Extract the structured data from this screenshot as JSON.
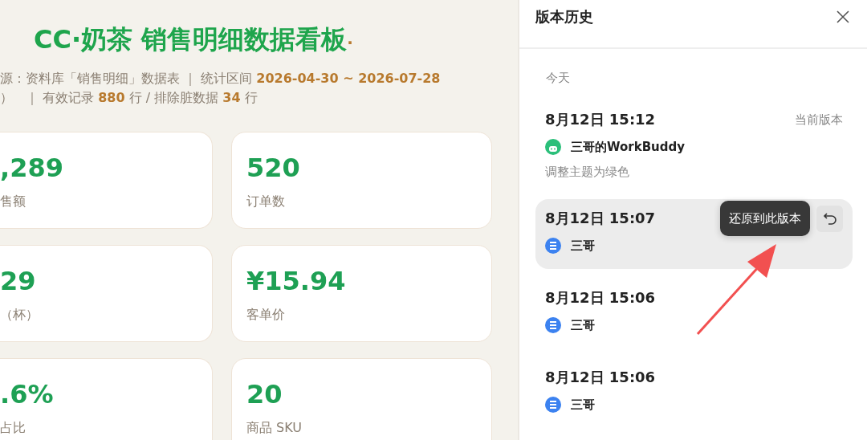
{
  "dashboard": {
    "title": "CC·奶茶 销售明细数据看板",
    "title_mark": "·",
    "meta_lines": [
      [
        {
          "text": "源：资料库「销售明细」数据表 ｜ 统计区间 ",
          "highlight": false
        },
        {
          "text": "2026-04-30 ~ 2026-07-28",
          "highlight": true
        }
      ],
      [
        {
          "text": "）　｜ 有效记录 ",
          "highlight": false
        },
        {
          "text": "880",
          "highlight": true
        },
        {
          "text": " 行 / 排除脏数据 ",
          "highlight": false
        },
        {
          "text": "34",
          "highlight": true
        },
        {
          "text": " 行",
          "highlight": false
        }
      ]
    ],
    "cards": [
      {
        "value": ",289",
        "label": "售额",
        "cut": true
      },
      {
        "value": "520",
        "label": "订单数",
        "cut": false
      },
      {
        "value": "29",
        "label": "（杯）",
        "cut": true
      },
      {
        "value": "¥15.94",
        "label": "客单价",
        "cut": false
      },
      {
        "value": ".6%",
        "label": "占比",
        "cut": true
      },
      {
        "value": "20",
        "label": "商品 SKU",
        "cut": false
      }
    ]
  },
  "panel": {
    "title": "版本历史",
    "group": "今天",
    "versions": [
      {
        "time": "8月12日 15:12",
        "author": "三哥的WorkBuddy",
        "kind": "bot",
        "note": "调整主题为绿色",
        "badge": "当前版本",
        "highlighted": false
      },
      {
        "time": "8月12日 15:07",
        "author": "三哥",
        "kind": "user",
        "highlighted": true,
        "tooltip": "还原到此版本"
      },
      {
        "time": "8月12日 15:06",
        "author": "三哥",
        "kind": "user",
        "highlighted": false
      },
      {
        "time": "8月12日 15:06",
        "author": "三哥",
        "kind": "user",
        "highlighted": false
      }
    ]
  }
}
